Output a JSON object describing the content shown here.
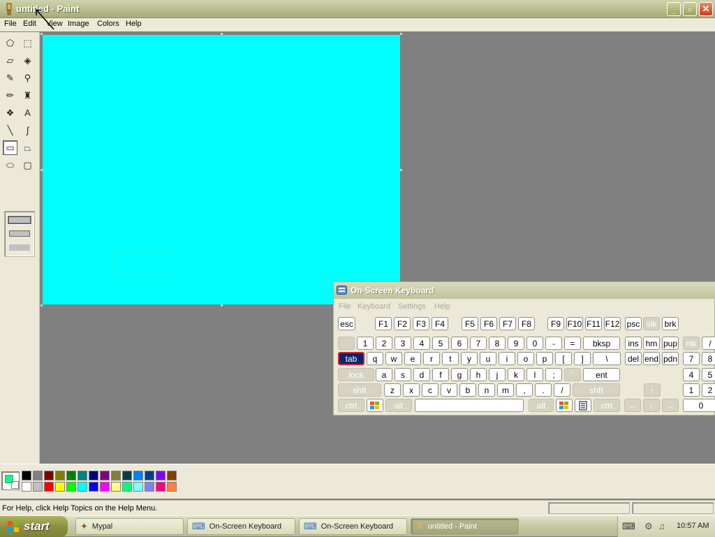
{
  "window": {
    "title": "untitled - Paint",
    "minimize": "_",
    "maximize": "▫",
    "close": "✕"
  },
  "menu": [
    "File",
    "Edit",
    "View",
    "Image",
    "Colors",
    "Help"
  ],
  "tools": [
    {
      "icon": "free-form-select-icon",
      "glyph": "⬠"
    },
    {
      "icon": "select-icon",
      "glyph": "⬚"
    },
    {
      "icon": "eraser-icon",
      "glyph": "▱"
    },
    {
      "icon": "fill-icon",
      "glyph": "◈"
    },
    {
      "icon": "pick-color-icon",
      "glyph": "✎"
    },
    {
      "icon": "magnifier-icon",
      "glyph": "⚲"
    },
    {
      "icon": "pencil-icon",
      "glyph": "✏"
    },
    {
      "icon": "brush-icon",
      "glyph": "♜"
    },
    {
      "icon": "airbrush-icon",
      "glyph": "❖"
    },
    {
      "icon": "text-icon",
      "glyph": "A"
    },
    {
      "icon": "line-icon",
      "glyph": "╲"
    },
    {
      "icon": "curve-icon",
      "glyph": "∫"
    },
    {
      "icon": "rectangle-icon",
      "glyph": "▭"
    },
    {
      "icon": "polygon-icon",
      "glyph": "⏢"
    },
    {
      "icon": "ellipse-icon",
      "glyph": "⬭"
    },
    {
      "icon": "rounded-rectangle-icon",
      "glyph": "▢"
    }
  ],
  "palette": {
    "top": [
      "#000000",
      "#808080",
      "#800000",
      "#808000",
      "#008000",
      "#008080",
      "#000080",
      "#800080",
      "#808040",
      "#004040",
      "#0080ff",
      "#004080",
      "#8000ff",
      "#804000"
    ],
    "bottom": [
      "#ffffff",
      "#c0c0c0",
      "#ff0000",
      "#ffff00",
      "#00ff00",
      "#00ffff",
      "#0000ff",
      "#ff00ff",
      "#ffff80",
      "#00ff80",
      "#80ffff",
      "#8080ff",
      "#ff0080",
      "#ff8040"
    ],
    "foreground": "#00ff80",
    "background": "#ffffff"
  },
  "canvas": {
    "color": "#00ffff"
  },
  "status": "For Help, click Help Topics on the Help Menu.",
  "osk": {
    "title": "On-Screen Keyboard",
    "menu": [
      "File",
      "Keyboard",
      "Settings",
      "Help"
    ],
    "rows": [
      [
        "esc",
        "F1",
        "F2",
        "F3",
        "F4",
        "F5",
        "F6",
        "F7",
        "F8",
        "F9",
        "F10",
        "F11",
        "F12",
        "psc",
        "slk",
        "brk"
      ],
      [
        "`",
        "1",
        "2",
        "3",
        "4",
        "5",
        "6",
        "7",
        "8",
        "9",
        "0",
        "-",
        "=",
        "bksp",
        "ins",
        "hm",
        "pup",
        "nlk",
        "/"
      ],
      [
        "tab",
        "q",
        "w",
        "e",
        "r",
        "t",
        "y",
        "u",
        "i",
        "o",
        "p",
        "[",
        "]",
        "\\",
        "del",
        "end",
        "pdn",
        "7",
        "8"
      ],
      [
        "lock",
        "a",
        "s",
        "d",
        "f",
        "g",
        "h",
        "j",
        "k",
        "l",
        ";",
        "'",
        "ent",
        "4",
        "5"
      ],
      [
        "shft",
        "z",
        "x",
        "c",
        "v",
        "b",
        "n",
        "m",
        ",",
        ".",
        "/",
        "shft",
        "↑",
        "1",
        "2"
      ],
      [
        "ctrl",
        "win",
        "alt",
        "",
        "alt",
        "win",
        "menu",
        "ctrl",
        "←",
        "↓",
        "→",
        "0"
      ]
    ]
  },
  "taskbar": {
    "start": "start",
    "tasks": [
      {
        "label": "Mypal",
        "active": false
      },
      {
        "label": "On-Screen Keyboard",
        "active": false
      },
      {
        "label": "On-Screen Keyboard",
        "active": false
      },
      {
        "label": "untitled - Paint",
        "active": true
      }
    ],
    "clock": "10:57 AM"
  }
}
